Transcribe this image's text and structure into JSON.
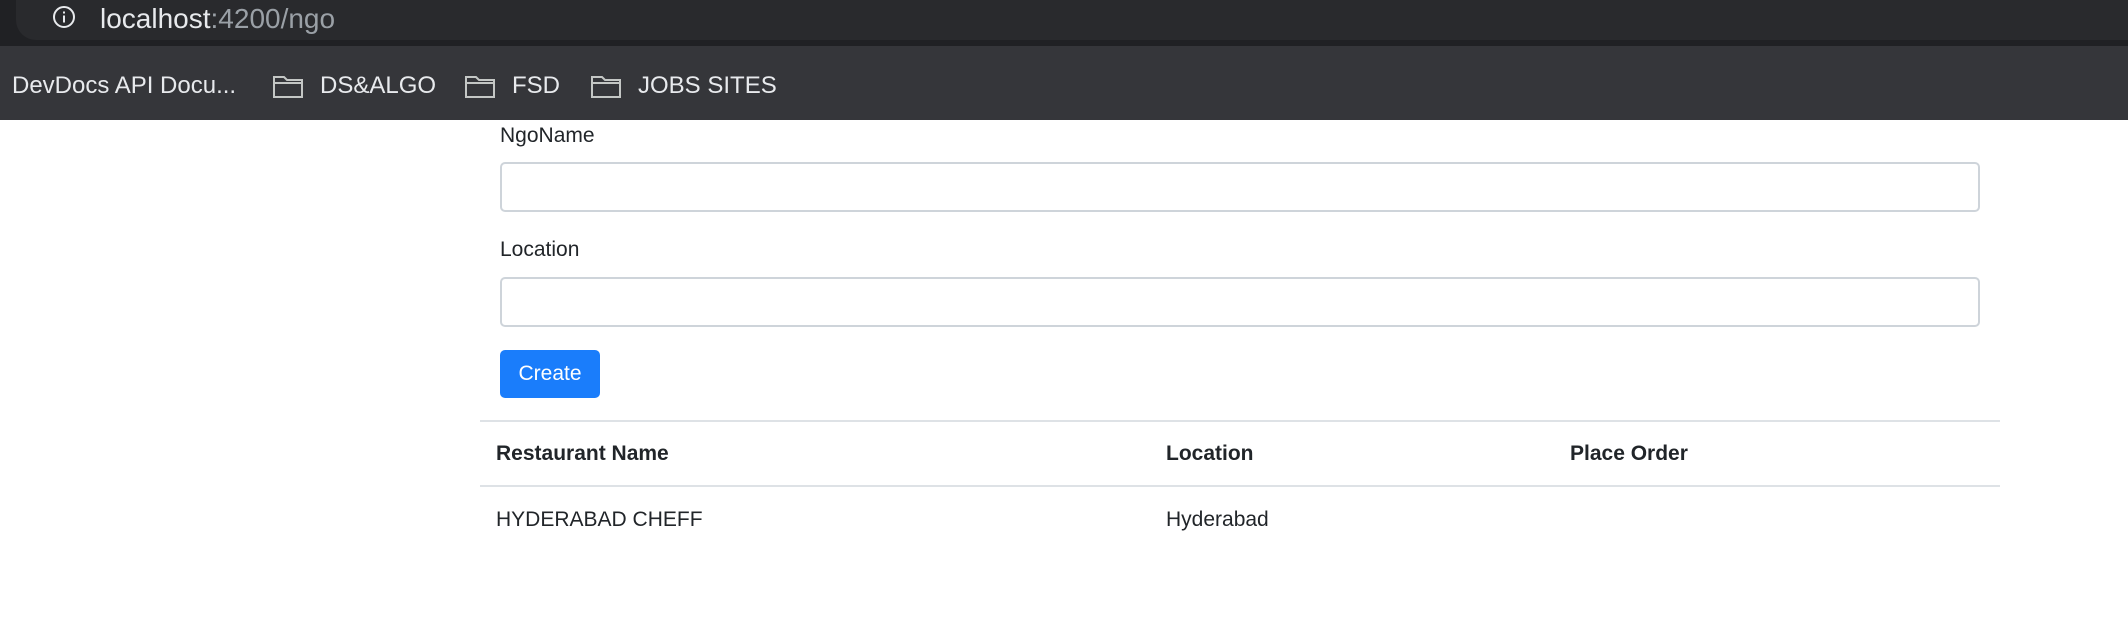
{
  "browser": {
    "url_host": "localhost",
    "url_rest": ":4200/ngo",
    "bookmarks": [
      {
        "label": "DevDocs API Docu...",
        "icon": "none"
      },
      {
        "label": "DS&ALGO",
        "icon": "folder-icon"
      },
      {
        "label": "FSD",
        "icon": "folder-icon"
      },
      {
        "label": "JOBS SITES",
        "icon": "folder-icon"
      }
    ]
  },
  "form": {
    "ngo_name_label": "NgoName",
    "ngo_name_value": "",
    "location_label": "Location",
    "location_value": "",
    "create_label": "Create"
  },
  "table": {
    "headers": [
      "Restaurant Name",
      "Location",
      "Place Order"
    ],
    "rows": [
      [
        "HYDERABAD CHEFF",
        "Hyderabad",
        ""
      ]
    ]
  },
  "colors": {
    "primary": "#1a7dfb",
    "chrome_dark": "#202124",
    "bookmark_bar": "#35363a"
  }
}
